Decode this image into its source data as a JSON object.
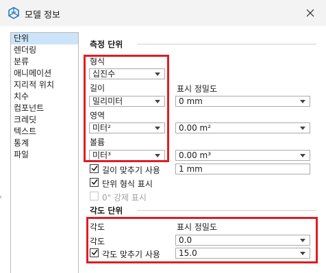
{
  "window": {
    "title": "모델 정보"
  },
  "sidebar": {
    "items": [
      {
        "label": "단위",
        "selected": true
      },
      {
        "label": "렌더링",
        "selected": false
      },
      {
        "label": "분류",
        "selected": false
      },
      {
        "label": "애니메이션",
        "selected": false
      },
      {
        "label": "지리적 위치",
        "selected": false
      },
      {
        "label": "치수",
        "selected": false
      },
      {
        "label": "컴포넌트",
        "selected": false
      },
      {
        "label": "크레딧",
        "selected": false
      },
      {
        "label": "텍스트",
        "selected": false
      },
      {
        "label": "통계",
        "selected": false
      },
      {
        "label": "파일",
        "selected": false
      }
    ]
  },
  "length_units": {
    "header": "측정 단위",
    "format_label": "형식",
    "format_value": "십진수",
    "length_label": "길이",
    "length_value": "밀리미터",
    "precision_label": "표시 정밀도",
    "length_precision": "0 mm",
    "area_label": "영역",
    "area_value": "미터²",
    "area_precision": "0.00 m²",
    "volume_label": "볼륨",
    "volume_value": "미터³",
    "volume_precision": "0.00 m³",
    "length_snap_label": "길이 맞추기 사용",
    "length_snap_checked": true,
    "length_snap_value": "1 mm",
    "display_format_label": "단위 형식 표시",
    "display_format_checked": true,
    "force_zero_label": "0\" 강제 표시",
    "force_zero_checked": false
  },
  "angle_units": {
    "header": "각도 단위",
    "angle_header": "각도",
    "precision_header": "표시 정밀도",
    "angle_label": "각도",
    "angle_precision": "0.0",
    "snap_label": "각도 맞추기 사용",
    "snap_checked": true,
    "snap_value": "15.0"
  },
  "colors": {
    "highlight": "#e11b22",
    "selection": "#cce4f7",
    "app_icon": "#2b7bbd"
  }
}
